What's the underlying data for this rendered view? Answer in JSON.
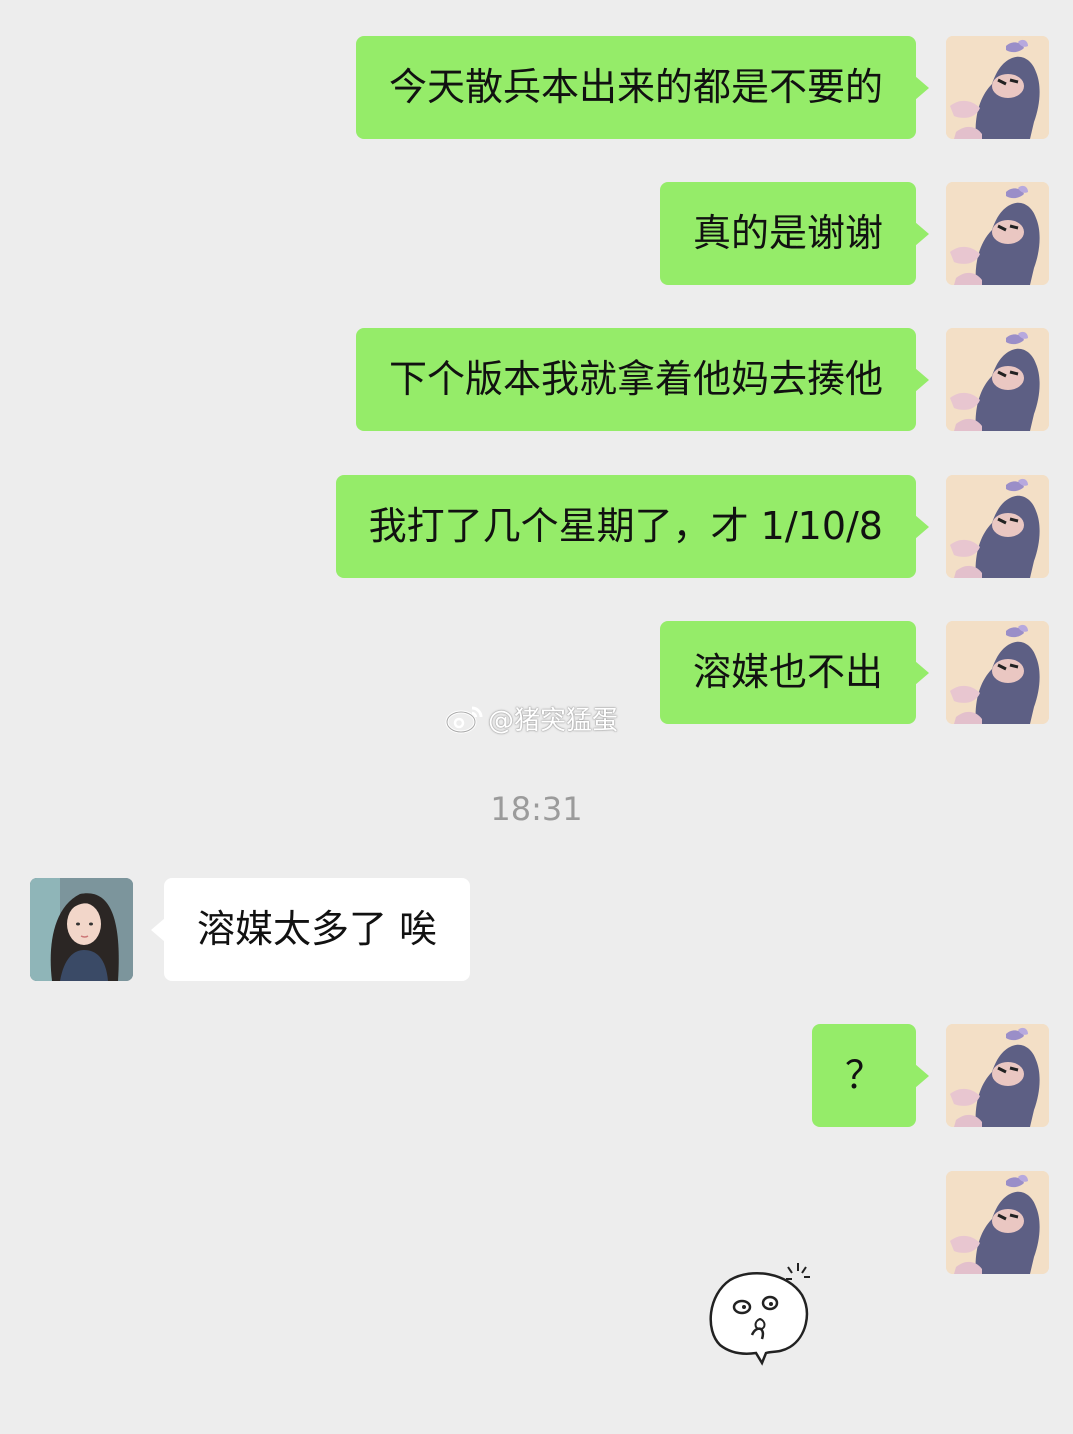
{
  "messages": [
    {
      "text": "今天散兵本出来的都是不要的"
    },
    {
      "text": "真的是谢谢"
    },
    {
      "text": "下个版本我就拿着他妈去揍他"
    },
    {
      "text": "我打了几个星期了，才 1/10/8"
    },
    {
      "text": "溶媒也不出"
    },
    {
      "text": "溶媒太多了 唉"
    },
    {
      "text": "？"
    }
  ],
  "timestamp": "18:31",
  "watermark": "@猪突猛蛋",
  "icons": {
    "my_avatar": "cartoon-cat-avatar",
    "other_avatar": "girl-photo-avatar",
    "watermark_logo": "weibo-logo-icon",
    "sticker": "doodle-face-sticker"
  },
  "colors": {
    "outgoing_bubble": "#95ec69",
    "incoming_bubble": "#ffffff",
    "background": "#ededed"
  }
}
